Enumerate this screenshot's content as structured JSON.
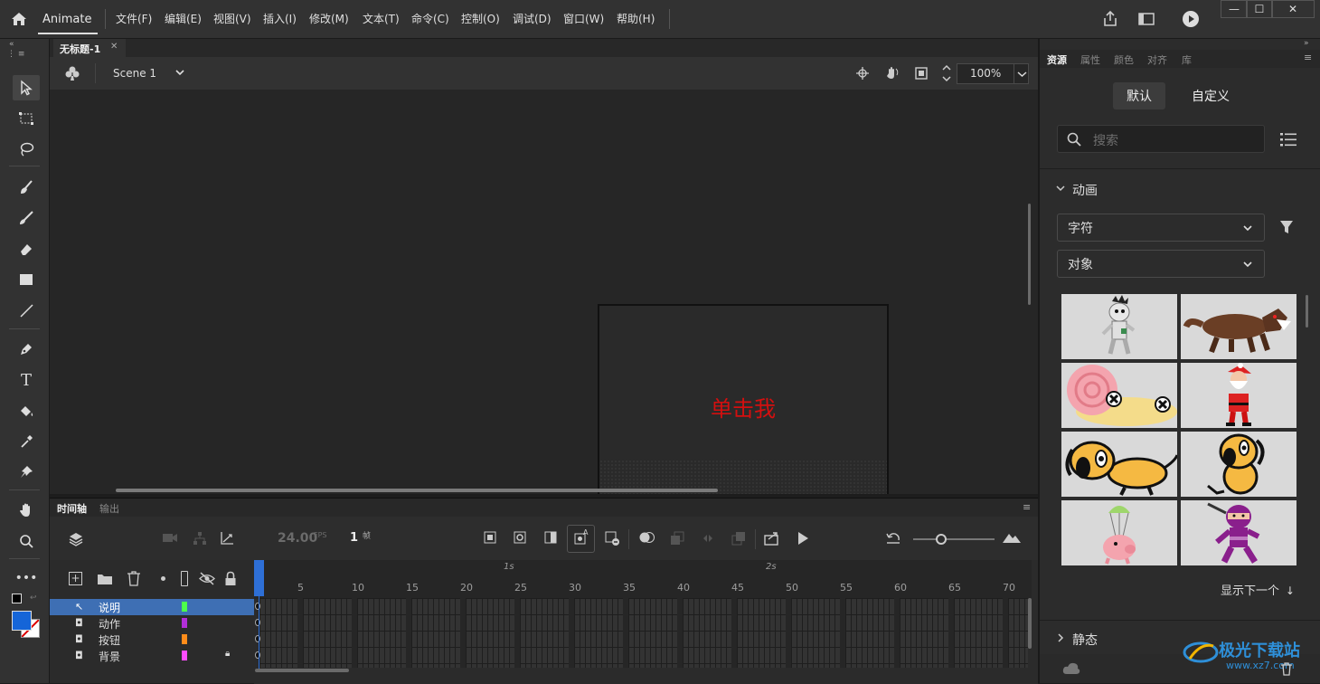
{
  "menubar": {
    "app_name": "Animate",
    "items": [
      "文件(F)",
      "编辑(E)",
      "视图(V)",
      "插入(I)",
      "修改(M)",
      "文本(T)",
      "命令(C)",
      "控制(O)",
      "调试(D)",
      "窗口(W)",
      "帮助(H)"
    ]
  },
  "document": {
    "tab_title": "无标题-1",
    "scene_name": "Scene 1",
    "zoom": "100%",
    "stage_text": "单击我",
    "stage_text_color": "#d40f0f"
  },
  "timeline": {
    "tabs": [
      "时间轴",
      "输出"
    ],
    "fps": "24.00",
    "fps_unit": "FPS",
    "current_frame": "1",
    "frame_unit": "帧",
    "second_markers": [
      "1s",
      "2s"
    ],
    "frame_numbers": [
      "5",
      "10",
      "15",
      "20",
      "25",
      "30",
      "35",
      "40",
      "45",
      "50",
      "55",
      "60",
      "65",
      "70"
    ],
    "layers": [
      {
        "name": "说明",
        "color": "#4cff4c",
        "selected": true,
        "locked": false
      },
      {
        "name": "动作",
        "color": "#b22fd8",
        "selected": false,
        "locked": false
      },
      {
        "name": "按钮",
        "color": "#ff8c1a",
        "selected": false,
        "locked": false
      },
      {
        "name": "背景",
        "color": "#ff4cff",
        "selected": false,
        "locked": true
      }
    ]
  },
  "assets_panel": {
    "tabs": [
      "资源",
      "属性",
      "颜色",
      "对齐",
      "库"
    ],
    "active_tab": "资源",
    "segments": [
      "默认",
      "自定义"
    ],
    "search_placeholder": "搜索",
    "section_animation": "动画",
    "filter_character": "字符",
    "filter_object": "对象",
    "show_next": "显示下一个",
    "section_static": "静态",
    "thumbnails": [
      "mummy-character",
      "werewolf-character",
      "snail-character",
      "santa-character",
      "dog-lying-character",
      "dog-sitting-character",
      "parachute-pig-character",
      "ninja-character"
    ]
  },
  "watermark": {
    "text": "极光下载站",
    "url": "www.xz7.com"
  },
  "colors": {
    "accent": "#2e6fd6",
    "stroke_swatch": "#ffffff",
    "fill_swatch": "#1565d8"
  }
}
